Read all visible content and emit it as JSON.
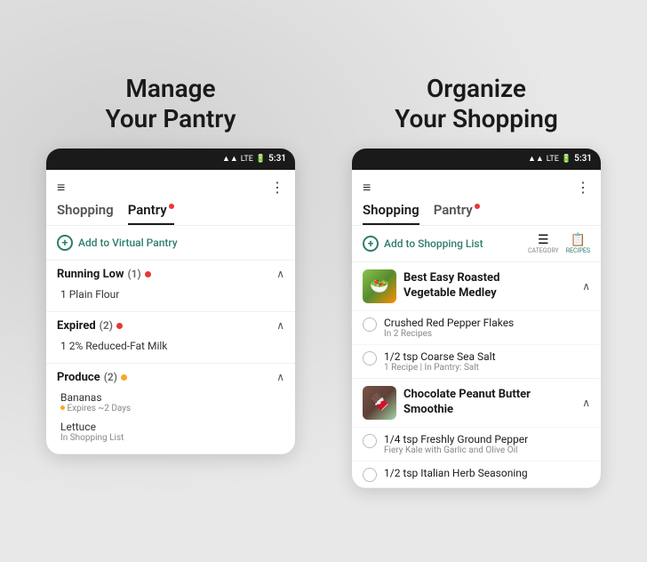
{
  "left_panel": {
    "title_line1": "Manage",
    "title_line2": "Your Pantry",
    "status_bar": {
      "time": "5:31"
    },
    "tabs": [
      {
        "label": "Shopping",
        "active": false
      },
      {
        "label": "Pantry",
        "active": true,
        "has_dot": true
      }
    ],
    "add_button_label": "Add to Virtual Pantry",
    "sections": [
      {
        "title": "Running Low",
        "count": "(1)",
        "dot_color": "red",
        "expanded": true,
        "items": [
          {
            "name": "1 Plain Flour",
            "sub": ""
          }
        ]
      },
      {
        "title": "Expired",
        "count": "(2)",
        "dot_color": "red",
        "expanded": true,
        "items": [
          {
            "name": "1 2% Reduced-Fat Milk",
            "sub": ""
          }
        ]
      },
      {
        "title": "Produce",
        "count": "(2)",
        "dot_color": "yellow",
        "expanded": true,
        "items": [
          {
            "name": "Bananas",
            "sub": "Expires ~2 Days"
          },
          {
            "name": "Lettuce",
            "sub": "In Shopping List"
          }
        ]
      }
    ]
  },
  "right_panel": {
    "title_line1": "Organize",
    "title_line2": "Your Shopping",
    "status_bar": {
      "time": "5:31"
    },
    "tabs": [
      {
        "label": "Shopping",
        "active": true
      },
      {
        "label": "Pantry",
        "active": false,
        "has_dot": true
      }
    ],
    "add_button_label": "Add to Shopping List",
    "toolbar": {
      "category_label": "CATEGORY",
      "recipes_label": "RECIPES"
    },
    "recipe_sections": [
      {
        "name": "Best Easy Roasted\nVegetable Medley",
        "ingredients": [
          {
            "name": "Crushed Red Pepper Flakes",
            "detail": "In 2 Recipes"
          },
          {
            "name": "1/2 tsp Coarse Sea Salt",
            "detail": "1 Recipe | In Pantry: Salt"
          }
        ]
      },
      {
        "name": "Chocolate Peanut Butter\nSmoothie",
        "ingredients": [
          {
            "name": "1/4 tsp Freshly Ground Pepper",
            "detail": "Fiery Kale with Garlic and Olive Oil"
          },
          {
            "name": "1/2 tsp Italian Herb Seasoning",
            "detail": ""
          }
        ]
      }
    ]
  }
}
